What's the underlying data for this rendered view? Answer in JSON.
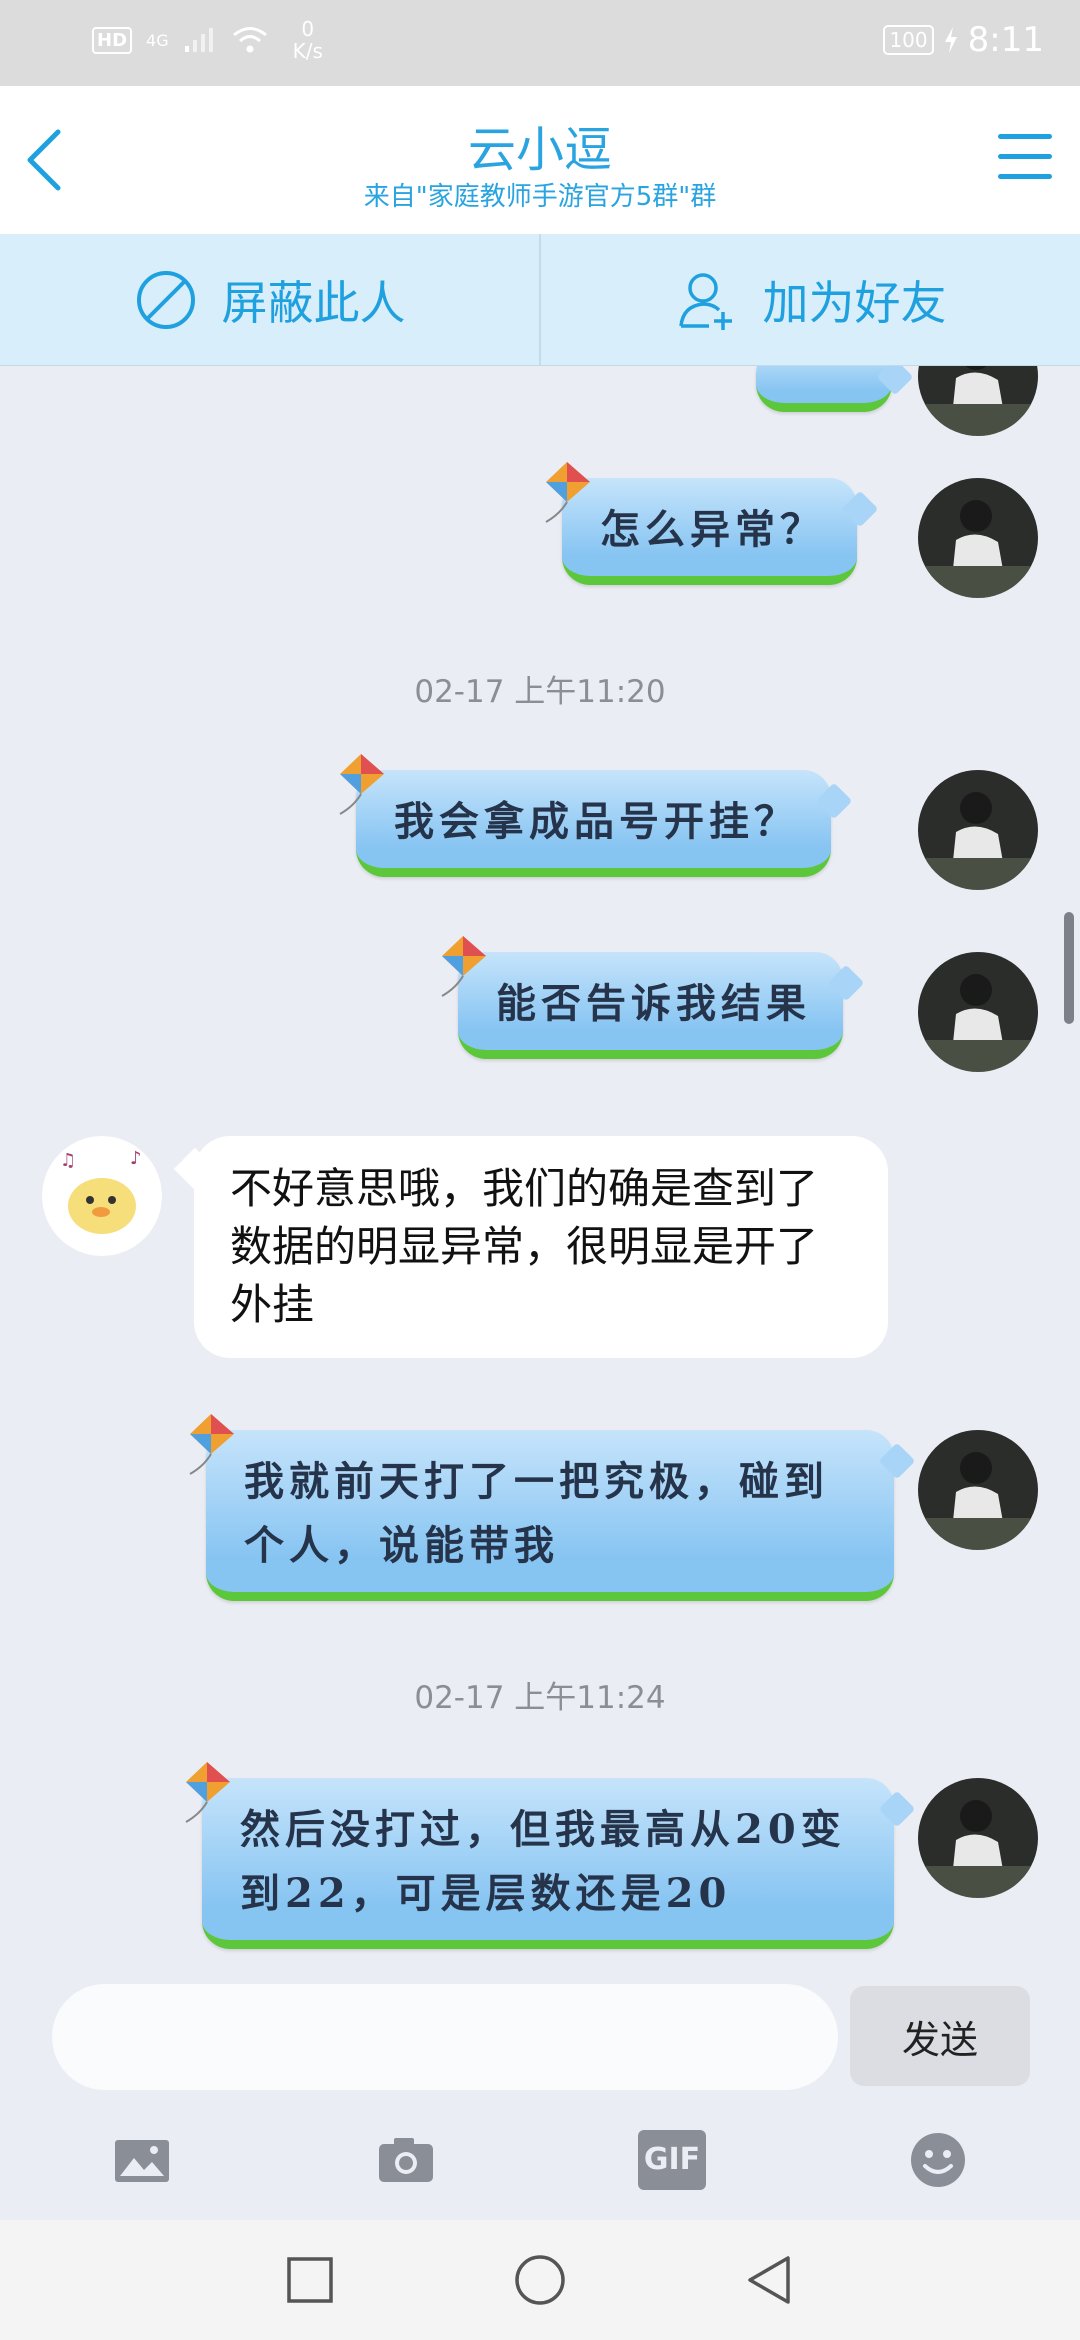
{
  "status_bar": {
    "hd": "HD",
    "network": "4G",
    "speed_value": "0",
    "speed_unit": "K/s",
    "battery": "100",
    "time": "8:11"
  },
  "header": {
    "title": "云小逗",
    "subtitle": "来自\"家庭教师手游官方5群\"群"
  },
  "actions": {
    "block_label": "屏蔽此人",
    "add_friend_label": "加为好友"
  },
  "messages": [
    {
      "id": "m0",
      "from": "me",
      "text": ""
    },
    {
      "id": "m1",
      "from": "me",
      "text": "怎么异常？"
    },
    {
      "id": "t1",
      "type": "timestamp",
      "text": "02-17 上午11:20"
    },
    {
      "id": "m2",
      "from": "me",
      "text": "我会拿成品号开挂？"
    },
    {
      "id": "m3",
      "from": "me",
      "text": "能否告诉我结果"
    },
    {
      "id": "m4",
      "from": "other",
      "text": "不好意思哦，我们的确是查到了数据的明显异常，很明显是开了外挂"
    },
    {
      "id": "m5",
      "from": "me",
      "text": "我就前天打了一把究极，碰到个人，说能带我"
    },
    {
      "id": "t2",
      "type": "timestamp",
      "text": "02-17 上午11:24"
    },
    {
      "id": "m6",
      "from": "me",
      "text": "然后没打过，但我最高从20变到22，可是层数还是20"
    }
  ],
  "input": {
    "placeholder": "",
    "send_label": "发送"
  },
  "toolbar": {
    "gif_label": "GIF"
  },
  "icons": [
    "back-icon",
    "menu-icon",
    "block-icon",
    "add-friend-icon",
    "image-icon",
    "camera-icon",
    "gif-icon",
    "emoji-icon",
    "recent-apps-icon",
    "home-icon",
    "nav-back-icon",
    "kite-icon"
  ],
  "colors": {
    "accent": "#1fa0df",
    "bubble_blue": "#86c4f2",
    "grass_green": "#5cc73a",
    "chat_bg": "#ebedf4"
  }
}
